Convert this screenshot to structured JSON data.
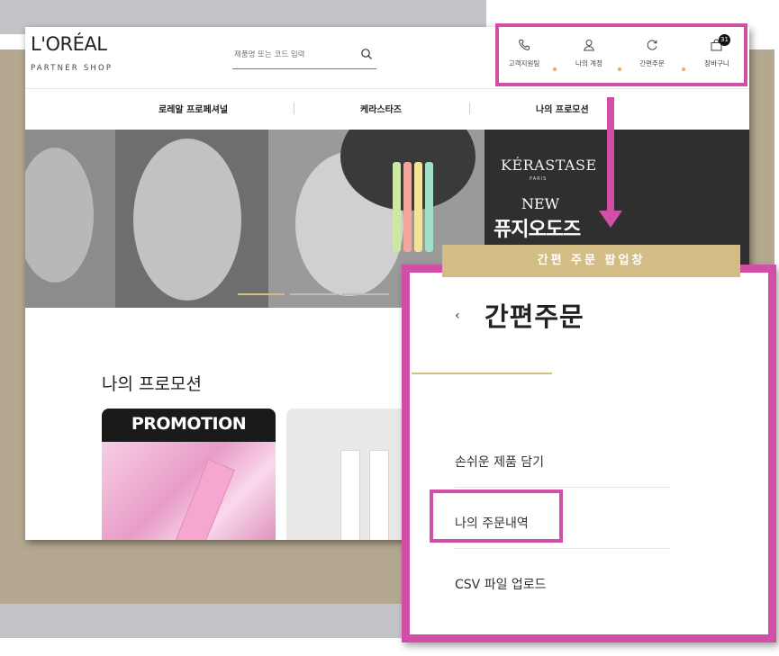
{
  "site": {
    "logo": {
      "main": "L'ORÉAL",
      "sub": "PARTNER SHOP"
    },
    "search": {
      "placeholder": "제품명 또는 코드 입력"
    },
    "quick_menu": [
      {
        "label": "고객지원팀",
        "icon": "phone-icon"
      },
      {
        "label": "나의 계정",
        "icon": "user-icon"
      },
      {
        "label": "간편주문",
        "icon": "refresh-icon"
      },
      {
        "label": "장바구니",
        "icon": "cart-icon",
        "badge": "31"
      }
    ],
    "nav": [
      {
        "label": "로레알 프로페셔널"
      },
      {
        "label": "케라스타즈"
      },
      {
        "label": "나의 프로모션"
      }
    ],
    "hero": {
      "brand": "KÉRASTASE",
      "brand_sub": "PARIS",
      "new_label": "NEW",
      "product": "퓨지오도즈"
    },
    "section_title": "나의 프로모션",
    "promo_card_label": "PROMOTION"
  },
  "popup": {
    "tag": "간편 주문 팝업창",
    "back_icon": "chevron-left-icon",
    "title": "간편주문",
    "items": [
      {
        "label": "손쉬운 제품 담기"
      },
      {
        "label": "나의 주문내역"
      },
      {
        "label": "CSV 파일 업로드"
      }
    ]
  },
  "colors": {
    "highlight": "#d24fa8",
    "gold": "#d4bd85",
    "tan_background": "#b5a890",
    "grey_background": "#c4c4c8"
  }
}
